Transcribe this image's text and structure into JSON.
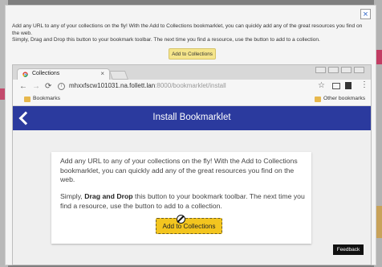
{
  "modal": {
    "line1": "Add any URL to any of your collections on the fly! With the Add to Collections bookmarklet, you can quickly add any of the great resources you find on the web.",
    "line2": "Simply, Drag and Drop this button to your bookmark toolbar. The next time you find a resource, use the button to add to a collection.",
    "button": "Add to Collections",
    "close": "×"
  },
  "browser": {
    "tab_title": "Collections",
    "tab_close": "×",
    "url_host": "mhxxfscw101031.na.follett.lan",
    "url_path": ":8000/bookmarklet/install",
    "bookmark1": "Bookmarks",
    "bookmark2": "Other bookmarks"
  },
  "page": {
    "title": "Install Bookmarklet",
    "para1": "Add any URL to any of your collections on the fly! With the Add to Collections bookmarklet, you can quickly add any of the great resources you find on the web.",
    "para2_pre": "Simply, ",
    "para2_bold": "Drag and Drop",
    "para2_post": " this button to your bookmark toolbar. The next time you find a resource, use the button to add to a collection.",
    "button": "Add to Collections",
    "feedback": "Feedback"
  },
  "icons": {
    "close": "close-icon",
    "chrome": "chrome-logo-icon",
    "back": "back-arrow-icon",
    "forward": "forward-arrow-icon",
    "reload": "reload-icon",
    "info": "info-icon",
    "star": "star-icon",
    "cast": "cast-icon",
    "film": "film-icon",
    "menu": "kebab-menu-icon",
    "folder": "folder-icon",
    "chevron": "chevron-left-icon",
    "blocked": "not-allowed-cursor-icon"
  },
  "colors": {
    "header": "#2b3a9e",
    "accent_yellow": "#f3c51f",
    "modal_button": "#f5e58b",
    "feedback_bg": "#111111"
  }
}
